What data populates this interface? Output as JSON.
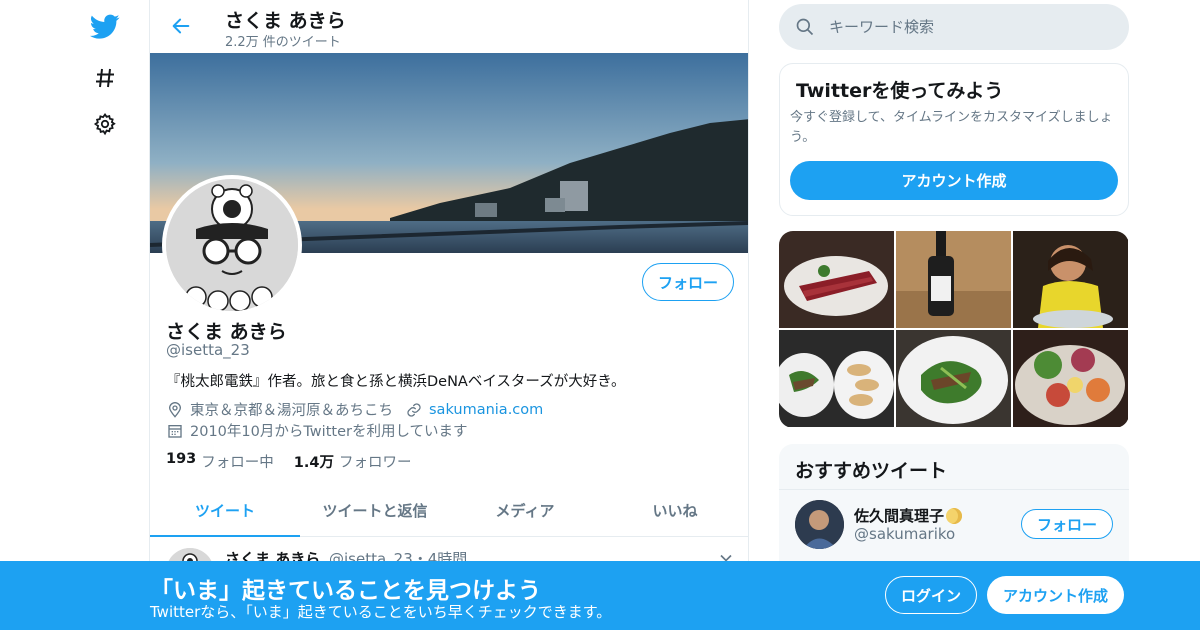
{
  "colors": {
    "accent": "#1da1f2",
    "secondary_text": "#657786",
    "border": "#e6ecf0"
  },
  "nav": {
    "icons": [
      "twitter-logo-icon",
      "hashtag-icon",
      "gear-icon"
    ]
  },
  "header": {
    "name": "さくま あきら",
    "tweet_count": "2.2万 件のツイート"
  },
  "profile": {
    "name": "さくま あきら",
    "handle": "@isetta_23",
    "follow_label": "フォロー",
    "bio": "『桃太郎電鉄』作者。旅と食と孫と横浜DeNAベイスターズが大好き。",
    "location": "東京＆京都＆湯河原＆あちこち",
    "website": "sakumania.com",
    "joined": "2010年10月からTwitterを利用しています",
    "following_count": "193",
    "following_label": "フォロー中",
    "followers_count": "1.4万",
    "followers_label": "フォロワー"
  },
  "tabs": [
    {
      "label": "ツイート",
      "active": true
    },
    {
      "label": "ツイートと返信",
      "active": false
    },
    {
      "label": "メディア",
      "active": false
    },
    {
      "label": "いいね",
      "active": false
    }
  ],
  "tweet": {
    "name": "さくま あきら",
    "meta": "@isetta_23・4時間"
  },
  "search": {
    "placeholder": "キーワード検索"
  },
  "signup_card": {
    "title": "Twitterを使ってみよう",
    "description": "今すぐ登録して、タイムラインをカスタマイズしましょう。",
    "button_label": "アカウント作成"
  },
  "media": [
    "sliced-beef",
    "sake-bottle",
    "person-eating",
    "stir-fry-and-gyoza",
    "stir-fry-plate",
    "salad-platter"
  ],
  "recommendations": {
    "title": "おすすめツイート",
    "items": [
      {
        "name": "佐久間真理子",
        "handle": "@sakumariko",
        "follow_label": "フォロー"
      }
    ]
  },
  "bottom_banner": {
    "title": "「いま」起きていることを見つけよう",
    "subtitle": "Twitterなら、「いま」起きていることをいち早くチェックできます。",
    "login_label": "ログイン",
    "signup_label": "アカウント作成"
  }
}
